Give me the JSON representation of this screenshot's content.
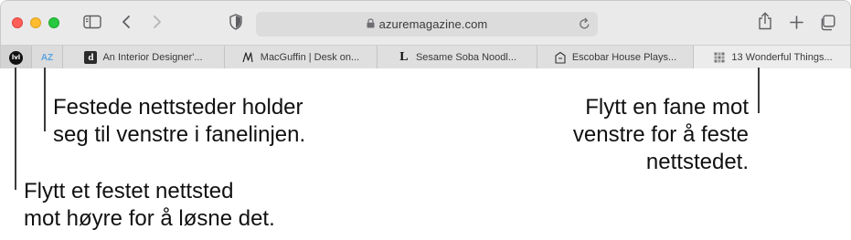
{
  "browser": {
    "address": "azuremagazine.com",
    "icons": {
      "sidebar": "sidebar-icon",
      "back": "chevron-left-icon",
      "forward": "chevron-right-icon",
      "privacy": "shield-icon",
      "lock": "lock-icon",
      "reload": "reload-icon",
      "share": "share-icon",
      "new_tab": "plus-icon",
      "tab_overview": "tab-overview-icon"
    },
    "traffic_colors": {
      "close": "#ff5f57",
      "minimize": "#febc2e",
      "zoom": "#28c840"
    }
  },
  "pinned_tabs": [
    {
      "label": "lvl",
      "icon": "round-logo-icon"
    },
    {
      "label": "AZ",
      "icon": "az-logo-icon"
    }
  ],
  "tabs": [
    {
      "favicon_letter": "d",
      "title": "An Interior Designer'..."
    },
    {
      "favicon_letter": "",
      "title": "MacGuffin | Desk on..."
    },
    {
      "favicon_letter": "L",
      "title": "Sesame Soba Noodl..."
    },
    {
      "favicon_letter": "",
      "title": "Escobar House Plays..."
    },
    {
      "favicon_letter": "",
      "title": "13 Wonderful Things..."
    }
  ],
  "callouts": {
    "pinned_left": "Festede nettsteder holder\nseg til venstre i fanelinjen.",
    "unpin": "Flytt et festet nettsted\nmot høyre for å løsne det.",
    "pin": "Flytt en fane mot\nvenstre for å feste\nnettstedet."
  }
}
